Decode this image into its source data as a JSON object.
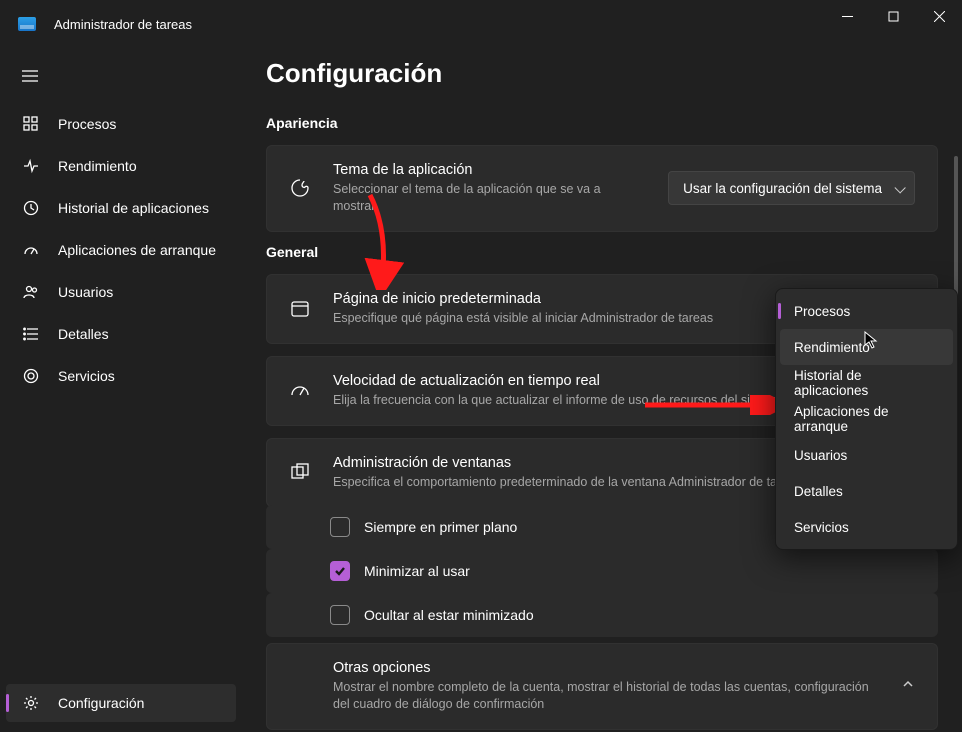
{
  "window": {
    "title": "Administrador de tareas"
  },
  "sidebar": {
    "items": [
      {
        "label": "Procesos"
      },
      {
        "label": "Rendimiento"
      },
      {
        "label": "Historial de aplicaciones"
      },
      {
        "label": "Aplicaciones de arranque"
      },
      {
        "label": "Usuarios"
      },
      {
        "label": "Detalles"
      },
      {
        "label": "Servicios"
      }
    ],
    "bottom": {
      "label": "Configuración"
    }
  },
  "page": {
    "title": "Configuración",
    "appearance": {
      "header": "Apariencia",
      "theme": {
        "title": "Tema de la aplicación",
        "desc": "Seleccionar el tema de la aplicación que se va a mostrar",
        "value": "Usar la configuración del sistema"
      }
    },
    "general": {
      "header": "General",
      "default_page": {
        "title": "Página de inicio predeterminada",
        "desc": "Especifique qué página está visible al iniciar Administrador de tareas"
      },
      "refresh": {
        "title": "Velocidad de actualización en tiempo real",
        "desc": "Elija la frecuencia con la que actualizar el informe de uso de recursos del sistema"
      },
      "window_mgmt": {
        "title": "Administración de ventanas",
        "desc": "Especifica el comportamiento predeterminado de la ventana Administrador de tareas",
        "opts": [
          {
            "label": "Siempre en primer plano",
            "checked": false
          },
          {
            "label": "Minimizar al usar",
            "checked": true
          },
          {
            "label": "Ocultar al estar minimizado",
            "checked": false
          }
        ]
      },
      "other": {
        "title": "Otras opciones",
        "desc": "Mostrar el nombre completo de la cuenta, mostrar el historial de todas las cuentas, configuración del cuadro de diálogo de confirmación"
      }
    }
  },
  "context_menu": {
    "items": [
      "Procesos",
      "Rendimiento",
      "Historial de aplicaciones",
      "Aplicaciones de arranque",
      "Usuarios",
      "Detalles",
      "Servicios"
    ],
    "selected_index": 0,
    "hover_index": 1
  }
}
